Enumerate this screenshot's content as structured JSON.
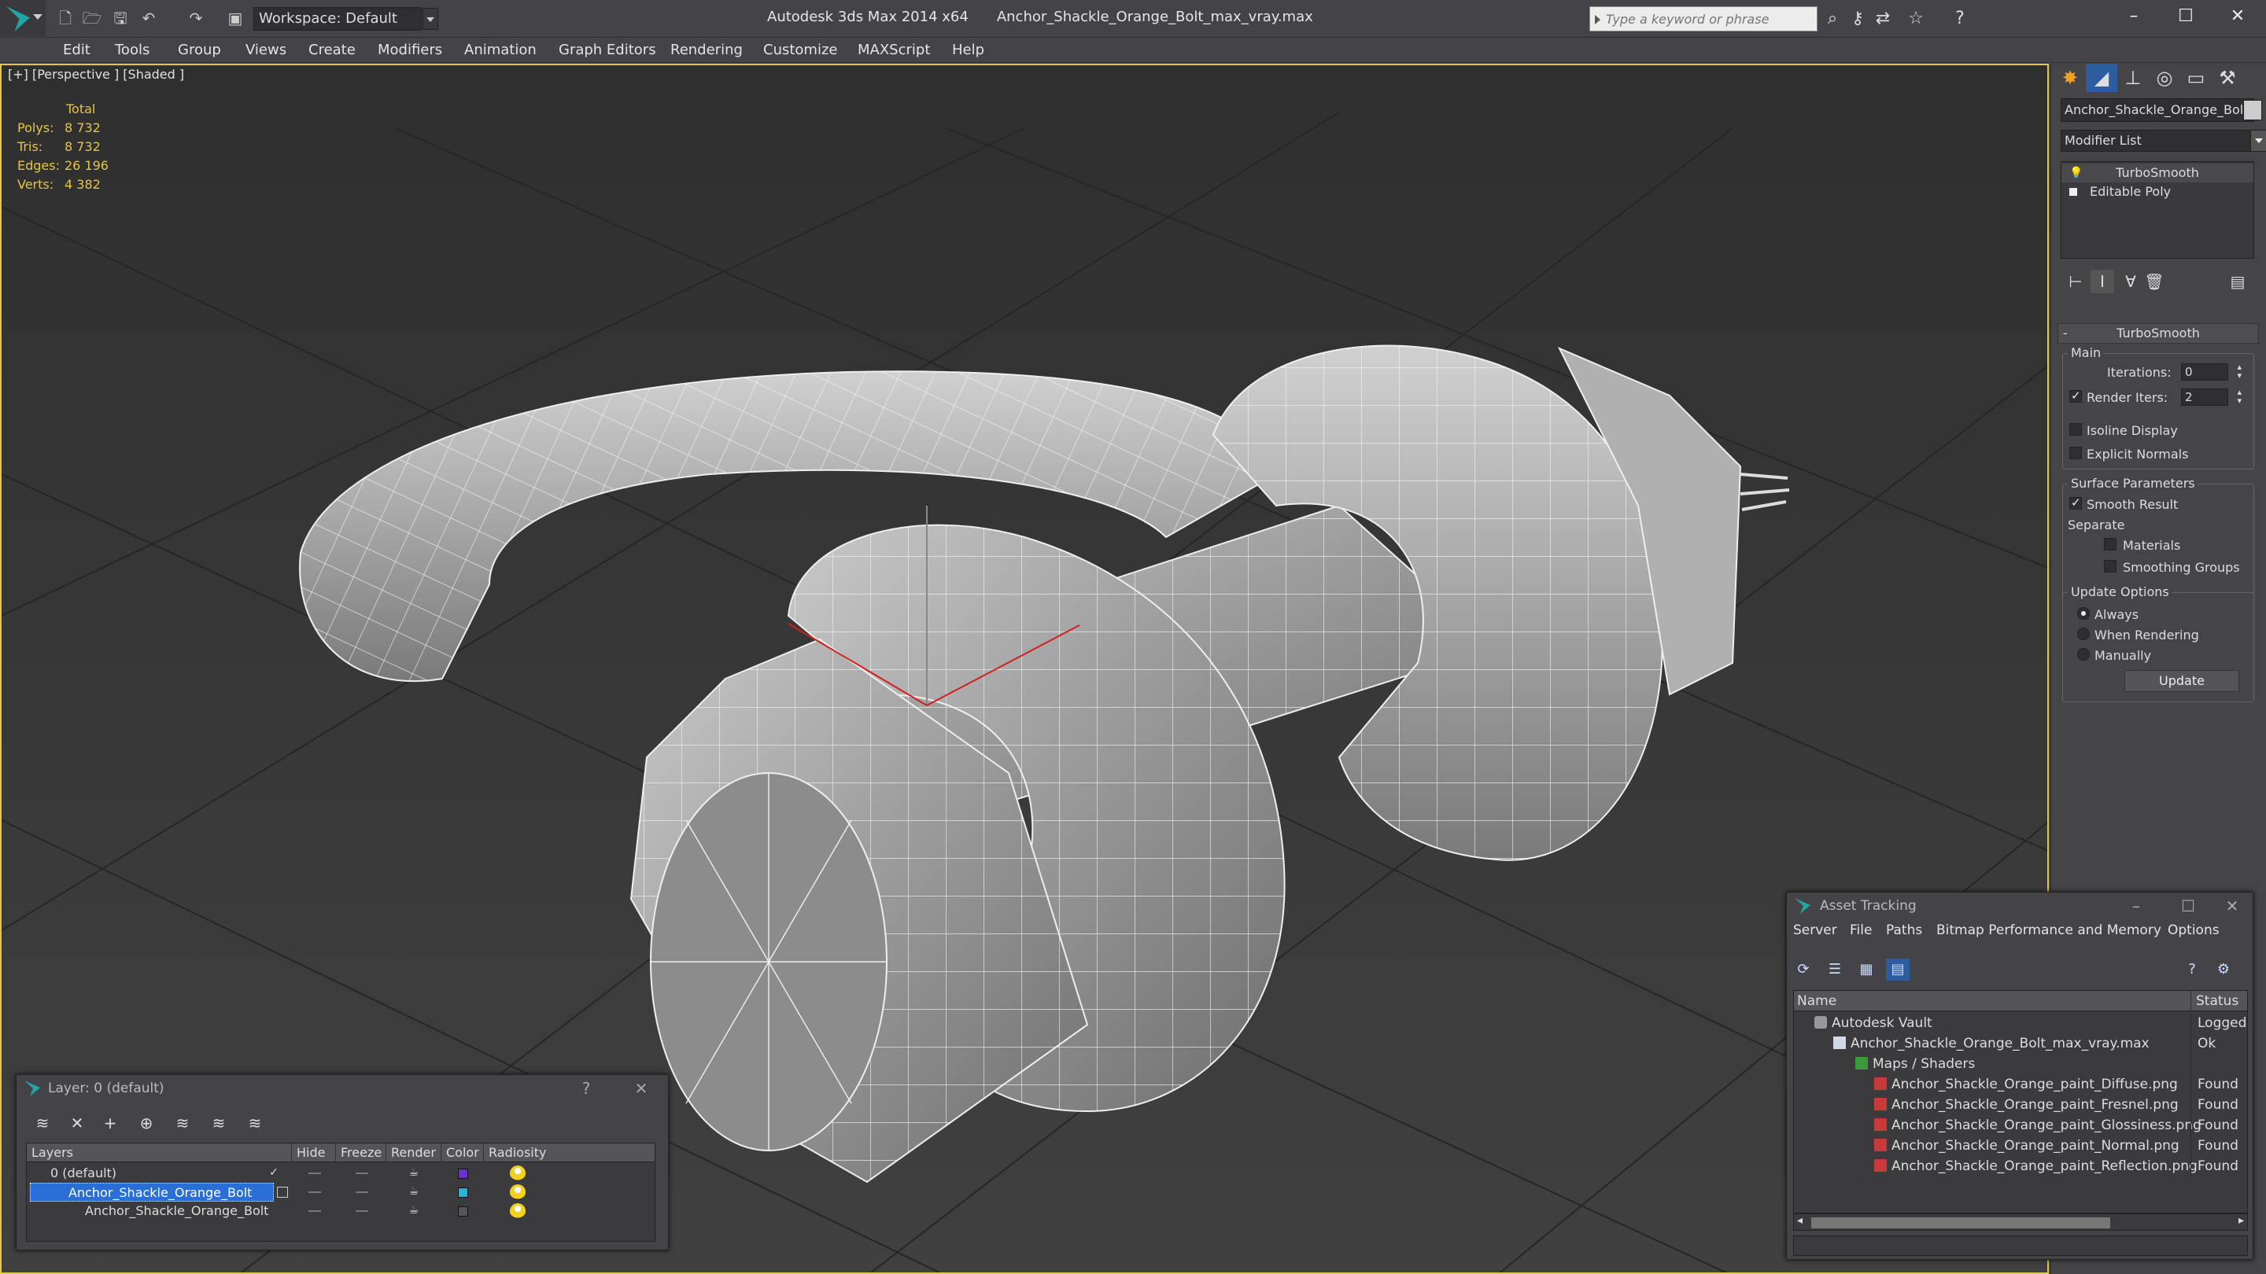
{
  "titlebar": {
    "workspace": "Workspace: Default",
    "app_name": "Autodesk 3ds Max  2014 x64",
    "file_name": "Anchor_Shackle_Orange_Bolt_max_vray.max",
    "search_placeholder": "Type a keyword or phrase"
  },
  "menu": [
    "Edit",
    "Tools",
    "Group",
    "Views",
    "Create",
    "Modifiers",
    "Animation",
    "Graph Editors",
    "Rendering",
    "Customize",
    "MAXScript",
    "Help"
  ],
  "viewport": {
    "label": "[+] [Perspective ] [Shaded ]",
    "stats": {
      "header": "Total",
      "rows": [
        {
          "k": "Polys:",
          "v": "8 732"
        },
        {
          "k": "Tris:",
          "v": "8 732"
        },
        {
          "k": "Edges:",
          "v": "26 196"
        },
        {
          "k": "Verts:",
          "v": "4 382"
        }
      ]
    }
  },
  "command_panel": {
    "object_name": "Anchor_Shackle_Orange_Bolt",
    "modifier_list": "Modifier List",
    "stack": [
      "TurboSmooth",
      "Editable Poly"
    ],
    "rollout_title": "TurboSmooth",
    "main_group": "Main",
    "iterations_label": "Iterations:",
    "iterations_value": "0",
    "render_iters_label": "Render Iters:",
    "render_iters_value": "2",
    "isoline": "Isoline Display",
    "explicit_normals": "Explicit Normals",
    "surface_group": "Surface Parameters",
    "smooth_result": "Smooth Result",
    "separate": "Separate",
    "materials": "Materials",
    "smoothing_groups": "Smoothing Groups",
    "update_group": "Update Options",
    "always": "Always",
    "when_rendering": "When Rendering",
    "manually": "Manually",
    "update_button": "Update"
  },
  "asset_tracking": {
    "title": "Asset Tracking",
    "menu": [
      "Server",
      "File",
      "Paths",
      "Bitmap Performance and Memory",
      "Options"
    ],
    "col_name": "Name",
    "col_status": "Status",
    "rows": [
      {
        "name": "Autodesk Vault",
        "status": "Logged O",
        "indent": 1
      },
      {
        "name": "Anchor_Shackle_Orange_Bolt_max_vray.max",
        "status": "Ok",
        "indent": 2
      },
      {
        "name": "Maps / Shaders",
        "status": "",
        "indent": 3
      },
      {
        "name": "Anchor_Shackle_Orange_paint_Diffuse.png",
        "status": "Found",
        "indent": 4
      },
      {
        "name": "Anchor_Shackle_Orange_paint_Fresnel.png",
        "status": "Found",
        "indent": 4
      },
      {
        "name": "Anchor_Shackle_Orange_paint_Glossiness.png",
        "status": "Found",
        "indent": 4
      },
      {
        "name": "Anchor_Shackle_Orange_paint_Normal.png",
        "status": "Found",
        "indent": 4
      },
      {
        "name": "Anchor_Shackle_Orange_paint_Reflection.png",
        "status": "Found",
        "indent": 4
      }
    ]
  },
  "layers": {
    "title": "Layer: 0 (default)",
    "help": "?",
    "columns": [
      "Layers",
      "Hide",
      "Freeze",
      "Render",
      "Color",
      "Radiosity"
    ],
    "rows": [
      {
        "name": "0 (default)",
        "color": "#6a2fd8"
      },
      {
        "name": "Anchor_Shackle_Orange_Bolt",
        "color": "#1fb6d8"
      },
      {
        "name": "Anchor_Shackle_Orange_Bolt",
        "color": "#555555"
      }
    ]
  }
}
